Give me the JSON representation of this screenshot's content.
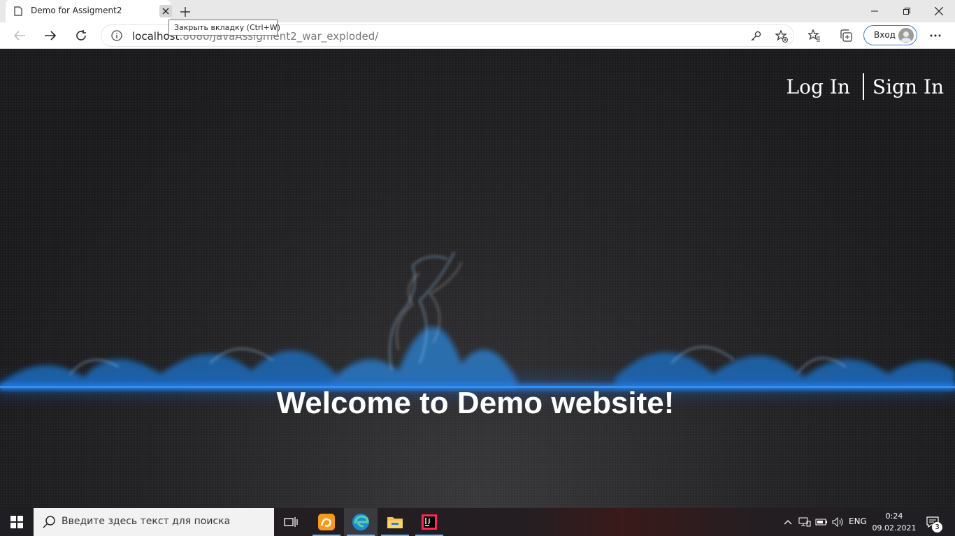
{
  "browser": {
    "tab_title": "Demo for Assigment2",
    "tooltip": "Закрыть вкладку (Ctrl+W)",
    "url_host": "localhost",
    "url_rest": ":8080/JavaAssigment2_war_exploded/",
    "profile_label": "Вход",
    "icons": [
      "page-icon",
      "close-icon",
      "plus-icon",
      "minimize-icon",
      "restore-icon",
      "close-window-icon",
      "back-icon",
      "forward-icon",
      "refresh-icon",
      "info-icon",
      "key-icon",
      "add-favorite-icon",
      "favorites-icon",
      "collections-icon",
      "more-icon"
    ]
  },
  "page": {
    "nav": {
      "login": "Log In",
      "signin": "Sign In"
    },
    "welcome": "Welcome to Demo website!"
  },
  "taskbar": {
    "search_placeholder": "Введите здесь текст для поиска",
    "language": "ENG",
    "time": "0:24",
    "date": "09.02.2021",
    "notifications": "3",
    "apps": [
      "task-view-icon",
      "uc-browser-icon",
      "edge-icon",
      "file-explorer-icon",
      "intellij-icon"
    ]
  },
  "colors": {
    "accent_blue": "#2f8ff3",
    "profile_border": "#3b7bd2"
  }
}
